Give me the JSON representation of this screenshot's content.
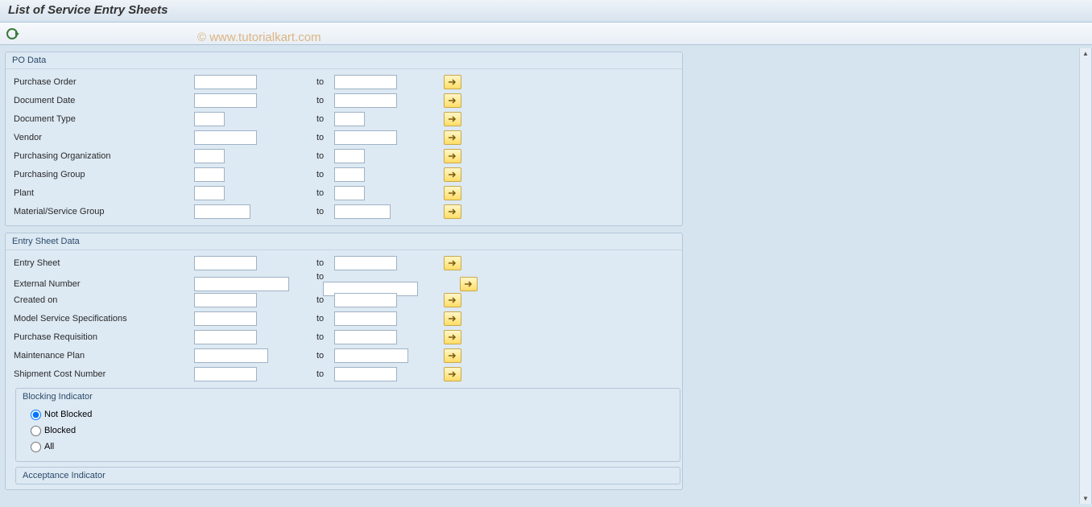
{
  "title": "List of Service Entry Sheets",
  "watermark": "© www.tutorialkart.com",
  "labels": {
    "to": "to"
  },
  "groups": {
    "po": {
      "title": "PO Data",
      "fields": {
        "purchase_order": "Purchase Order",
        "document_date": "Document Date",
        "document_type": "Document Type",
        "vendor": "Vendor",
        "purch_org": "Purchasing Organization",
        "purch_group": "Purchasing Group",
        "plant": "Plant",
        "mat_svc_group": "Material/Service Group"
      }
    },
    "entry": {
      "title": "Entry Sheet Data",
      "fields": {
        "entry_sheet": "Entry Sheet",
        "external_number": "External Number",
        "created_on": "Created on",
        "model_svc_spec": "Model Service Specifications",
        "purchase_req": "Purchase Requisition",
        "maint_plan": "Maintenance Plan",
        "shipment_cost": "Shipment Cost Number"
      },
      "blocking": {
        "title": "Blocking Indicator",
        "options": {
          "not_blocked": "Not Blocked",
          "blocked": "Blocked",
          "all": "All"
        },
        "selected": "not_blocked"
      },
      "acceptance": {
        "title": "Acceptance Indicator"
      }
    }
  }
}
